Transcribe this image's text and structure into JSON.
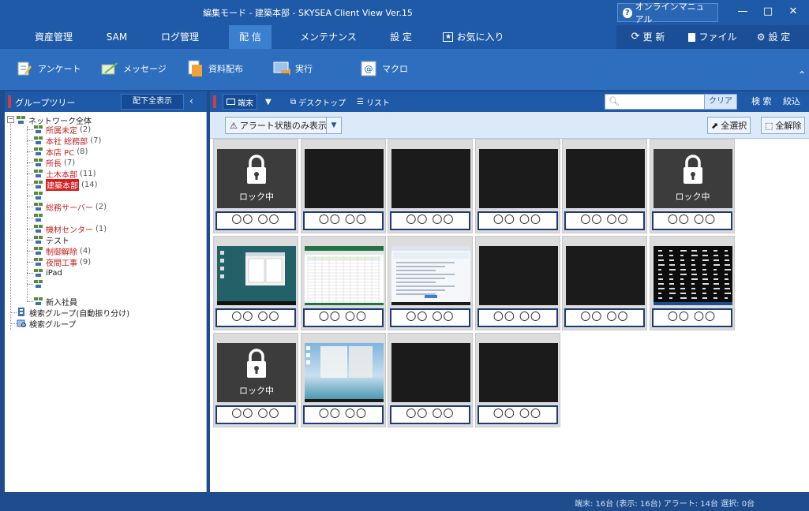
{
  "window": {
    "title": "編集モード - 建築本部 - SKYSEA Client View Ver.15",
    "manual_label": "オンラインマニュアル",
    "minimize": "—",
    "maximize": "□",
    "close": "✕"
  },
  "menu": {
    "items": [
      "資産管理",
      "SAM",
      "ログ管理",
      "配 信",
      "メンテナンス",
      "設 定",
      "お気に入り"
    ],
    "active": "配 信",
    "right": [
      "更 新",
      "ファイル",
      "設 定"
    ]
  },
  "ribbon": {
    "items": [
      "アンケート",
      "メッセージ",
      "資料配布",
      "実行",
      "マクロ"
    ]
  },
  "left_pane": {
    "title": "グループツリー",
    "show_all": "配下全表示",
    "tree": [
      {
        "label": "ネットワーク全体",
        "count": ""
      },
      {
        "label": "所属未定",
        "count": "(2)"
      },
      {
        "label": "本社 総務部",
        "count": "(7)"
      },
      {
        "label": "本店 PC",
        "count": "(8)"
      },
      {
        "label": "所長",
        "count": "(7)"
      },
      {
        "label": "土木本部",
        "count": "(11)"
      },
      {
        "label": "建築本部",
        "count": "(14)"
      },
      {
        "label": "",
        "count": ""
      },
      {
        "label": "総務サーバー",
        "count": "(2)"
      },
      {
        "label": "",
        "count": ""
      },
      {
        "label": "機材センター",
        "count": "(1)"
      },
      {
        "label": "テスト",
        "count": ""
      },
      {
        "label": "制御解除",
        "count": "(4)"
      },
      {
        "label": "夜間工事",
        "count": "(9)"
      },
      {
        "label": "iPad",
        "count": ""
      },
      {
        "label": "",
        "count": ""
      },
      {
        "label": "新入社員",
        "count": ""
      },
      {
        "label": "検索グループ(自動振り分け)",
        "count": ""
      },
      {
        "label": "検索グループ",
        "count": ""
      }
    ]
  },
  "right_pane": {
    "view_terminal": "端末",
    "view_desktop": "デスクトップ",
    "view_list": "リスト",
    "search_placeholder": "",
    "clear": "クリア",
    "search": "検 索",
    "filter": "絞込",
    "alert_only": "アラート状態のみ表示",
    "select_all": "全選択",
    "deselect_all": "全解除"
  },
  "tiles": [
    {
      "name": "〇〇 〇〇",
      "state": "locked",
      "lock_text": "ロック中"
    },
    {
      "name": "〇〇 〇〇",
      "state": "black"
    },
    {
      "name": "〇〇 〇〇",
      "state": "black"
    },
    {
      "name": "〇〇 〇〇",
      "state": "black"
    },
    {
      "name": "〇〇 〇〇",
      "state": "black"
    },
    {
      "name": "〇〇 〇〇",
      "state": "locked",
      "lock_text": "ロック中"
    },
    {
      "name": "〇〇 〇〇",
      "state": "desktop"
    },
    {
      "name": "〇〇 〇〇",
      "state": "spreadsheet"
    },
    {
      "name": "〇〇 〇〇",
      "state": "browser"
    },
    {
      "name": "〇〇 〇〇",
      "state": "black"
    },
    {
      "name": "〇〇 〇〇",
      "state": "black"
    },
    {
      "name": "〇〇 〇〇",
      "state": "terminal"
    },
    {
      "name": "〇〇 〇〇",
      "state": "locked",
      "lock_text": "ロック中"
    },
    {
      "name": "〇〇 〇〇",
      "state": "wallpaper"
    },
    {
      "name": "〇〇 〇〇",
      "state": "black"
    },
    {
      "name": "〇〇 〇〇",
      "state": "black"
    }
  ],
  "status": {
    "text": "端末:  16台 (表示:  16台)   アラート:  14台   選択:  0台"
  },
  "colors": {
    "accent": "#1e5aa8",
    "alert_red": "#c01e1e",
    "tile_border": "#1e3a78"
  }
}
